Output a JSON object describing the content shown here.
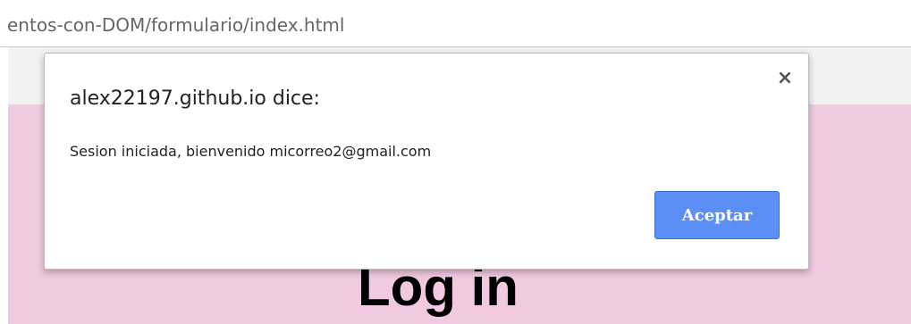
{
  "browser": {
    "url_fragment": "entos-con-DOM/formulario/index.html"
  },
  "page": {
    "heading": "Log in",
    "background_color": "#f1c9e1"
  },
  "alert_dialog": {
    "title": "alex22197.github.io dice:",
    "close_glyph": "×",
    "message": "Sesion iniciada, bienvenido micorreo2@gmail.com",
    "ok_label": "Aceptar",
    "ok_color": "#5b8ff5"
  }
}
